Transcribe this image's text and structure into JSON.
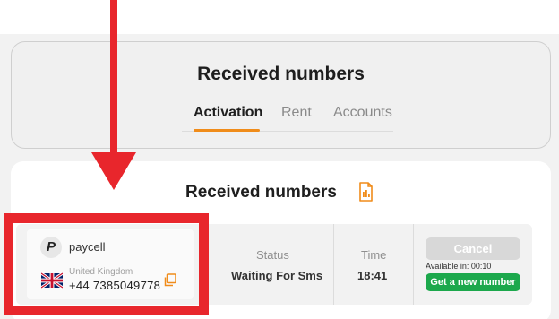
{
  "header": {
    "title": "Received numbers",
    "tabs": [
      {
        "label": "Activation",
        "active": true
      },
      {
        "label": "Rent",
        "active": false
      },
      {
        "label": "Accounts",
        "active": false
      }
    ],
    "accent_color": "#f08c1a"
  },
  "list": {
    "title": "Received numbers",
    "title_icon": "document-icon",
    "columns": {
      "status": "Status",
      "time": "Time"
    },
    "rows": [
      {
        "service": {
          "name": "paycell",
          "logo_letter": "P"
        },
        "country": "United Kingdom",
        "flag": "uk-flag-icon",
        "phone": "+44 7385049778",
        "status": "Waiting For Sms",
        "time": "18:41",
        "cancel_label": "Cancel",
        "available_in": "Available in: 00:10",
        "new_number_label": "Get a new number"
      }
    ]
  },
  "annotation": {
    "color": "#e8262c"
  }
}
